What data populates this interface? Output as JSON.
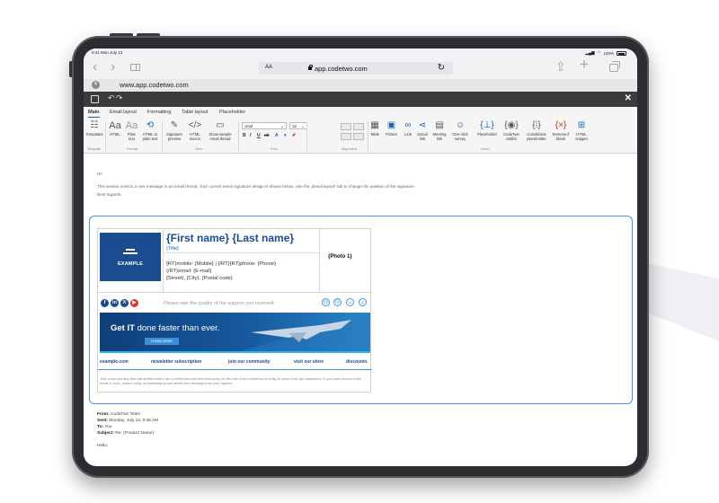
{
  "status_bar": {
    "time": "9:41 Mon July 13",
    "battery": "100%"
  },
  "browser": {
    "text_size": "AA",
    "url": "app.codetwo.com",
    "tab_title": "www.app.codetwo.com"
  },
  "ribbon_tabs": [
    "Main",
    "Email layout",
    "Formatting",
    "Table layout",
    "Placeholder"
  ],
  "ribbon": {
    "templates": "Templates",
    "html": "HTML",
    "plain_text": "Plain text",
    "html_to_plain": "HTML to plain text",
    "signature_preview": "Signature preview",
    "html_source": "HTML source",
    "show_sample": "Show sample email thread",
    "font_name": "Arial",
    "font_size": "12",
    "format_buttons": [
      "B",
      "I",
      "U",
      "ab",
      "A"
    ],
    "table": "Table",
    "picture": "Picture",
    "link": "Link",
    "social_link": "Social link",
    "meeting_link": "Meeting link",
    "survey": "One-click survey",
    "placeholder": "Placeholder",
    "codetwo_attribs": "CodeTwo attribs",
    "conditional": "Conditional placeholder",
    "remove_blank": "Remove if blank",
    "html_snippet": "HTML snippet",
    "groups": [
      "Template",
      "Format",
      "View",
      "Font",
      "Alignment",
      "Insert"
    ]
  },
  "email": {
    "greeting": "Hi!",
    "line1": "This section mimics a new message in an email thread. Your current email signature design is shown below. Use the „Email layout” tab to change the position of the signature.",
    "regards": "Best regards,"
  },
  "signature": {
    "logo_text": "EXAMPLE",
    "name": "{First name} {Last name}",
    "title": "{Title}",
    "phones": "{RT}mobile: {Mobile}  |  {/RT}{RT}phone: {Phone}",
    "email": "{/RT}email: {E-mail}",
    "address": "{Street}, {City}, {Postal code}",
    "photo": "{Photo 1}",
    "rate_text": "Please rate the quality of the support you received:",
    "banner_headline_bold": "Get IT ",
    "banner_headline_light": "done faster than ever.",
    "banner_button": "LEARN MORE",
    "links": [
      "example.com",
      "newsletter subscription",
      "join our community",
      "visit our store",
      "discounts"
    ],
    "disclaimer": "This email and any files transmitted with it are confidential and intended solely for the use of the individual or entity to whom they are addressed. If you have received this email in error, please notify us immediately and delete the message from your system."
  },
  "thread": {
    "from_label": "From:",
    "from": "CodeTwo Team",
    "sent_label": "Sent:",
    "sent": "Monday, July 13, 9:35 AM",
    "to_label": "To:",
    "to": "You",
    "subject_label": "Subject:",
    "subject": "Re: {Product Name}",
    "hello": "Hello,"
  },
  "colors": {
    "accent": "#1a63b7",
    "brand_dark": "#1a4d8f",
    "frame": "#4a90e2",
    "appbar": "#3b3b3b"
  }
}
